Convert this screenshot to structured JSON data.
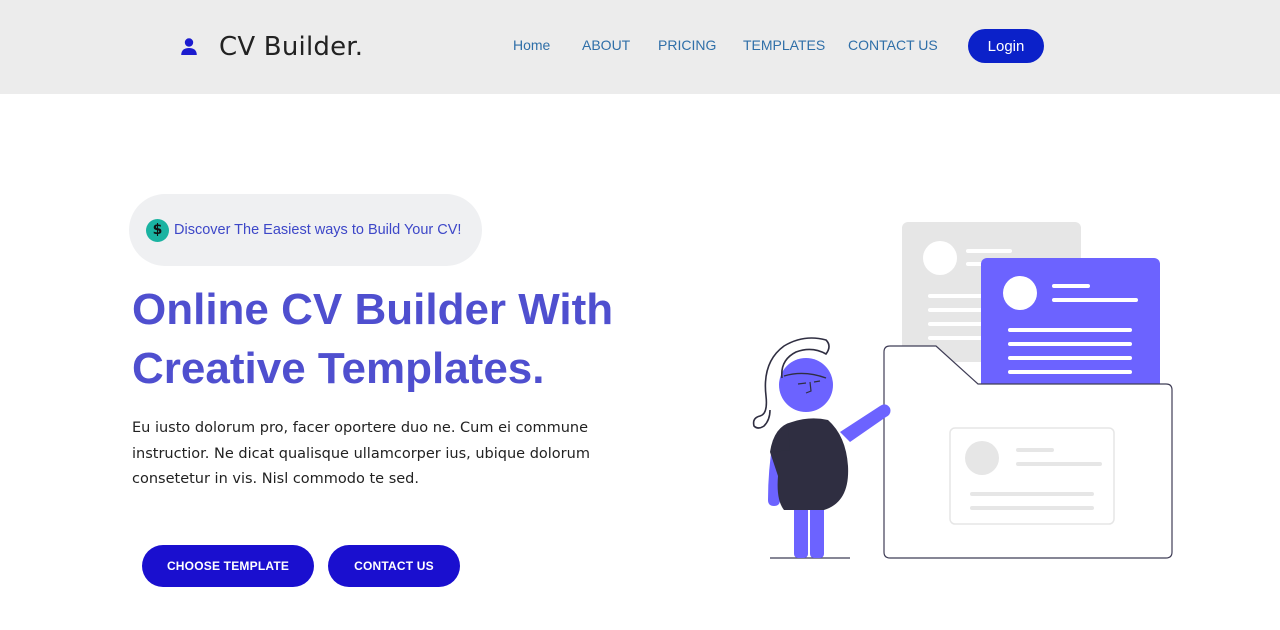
{
  "header": {
    "brand": "CV Builder.",
    "brand_icon": "user-icon",
    "nav": [
      {
        "label": "Home"
      },
      {
        "label": "ABOUT"
      },
      {
        "label": "PRICING"
      },
      {
        "label": "TEMPLATES"
      },
      {
        "label": "CONTACT US"
      }
    ],
    "login_label": "Login"
  },
  "hero": {
    "badge_icon": "dollar-icon",
    "badge_text": "Discover The Easiest ways to Build Your CV!",
    "title_line1": "Online CV Builder With",
    "title_line2": "Creative Templates.",
    "body": "Eu iusto dolorum pro, facer oportere duo ne. Cum ei commune instructior. Ne dicat qualisque ullamcorper ius, ubique dolorum consetetur in vis. Nisl commodo te sed.",
    "buttons": {
      "choose_template": "CHOOSE TEMPLATE",
      "contact_us": "CONTACT US"
    }
  },
  "colors": {
    "accent": "#0b21c9",
    "title": "#4f4fcf",
    "nav_link": "#2f6fa8",
    "illustration_purple": "#6c63ff",
    "header_bg": "#ececec"
  }
}
